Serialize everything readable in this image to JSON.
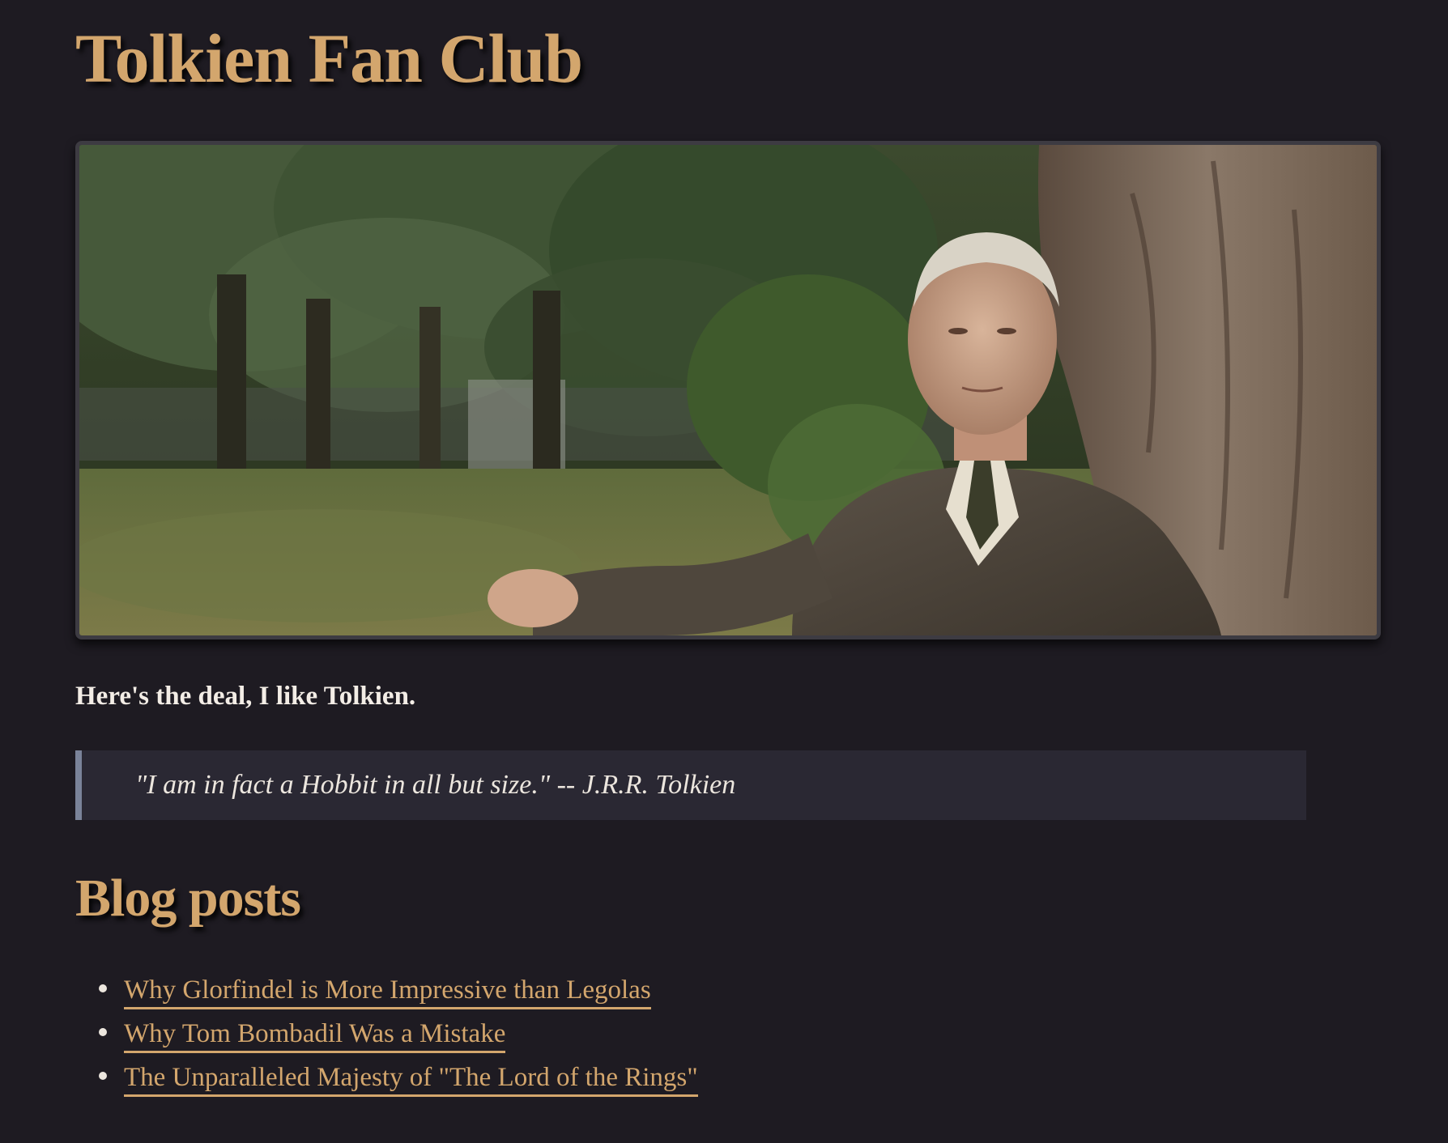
{
  "site": {
    "title": "Tolkien Fan Club"
  },
  "hero": {
    "alt": "Photo of J.R.R. Tolkien sitting against a tree in a park"
  },
  "intro": {
    "text": "Here's the deal, I like Tolkien."
  },
  "quote": {
    "text": "\"I am in fact a Hobbit in all but size.\" -- J.R.R. Tolkien"
  },
  "blog": {
    "title": "Blog posts",
    "posts": [
      {
        "label": "Why Glorfindel is More Impressive than Legolas"
      },
      {
        "label": "Why Tom Bombadil Was a Mistake"
      },
      {
        "label": "The Unparalleled Majesty of \"The Lord of the Rings\""
      }
    ]
  },
  "colors": {
    "background": "#1e1b22",
    "accent": "#d3a66d",
    "quote_bg": "#2a2833",
    "quote_border": "#7a8399",
    "text": "#f2ece4"
  }
}
